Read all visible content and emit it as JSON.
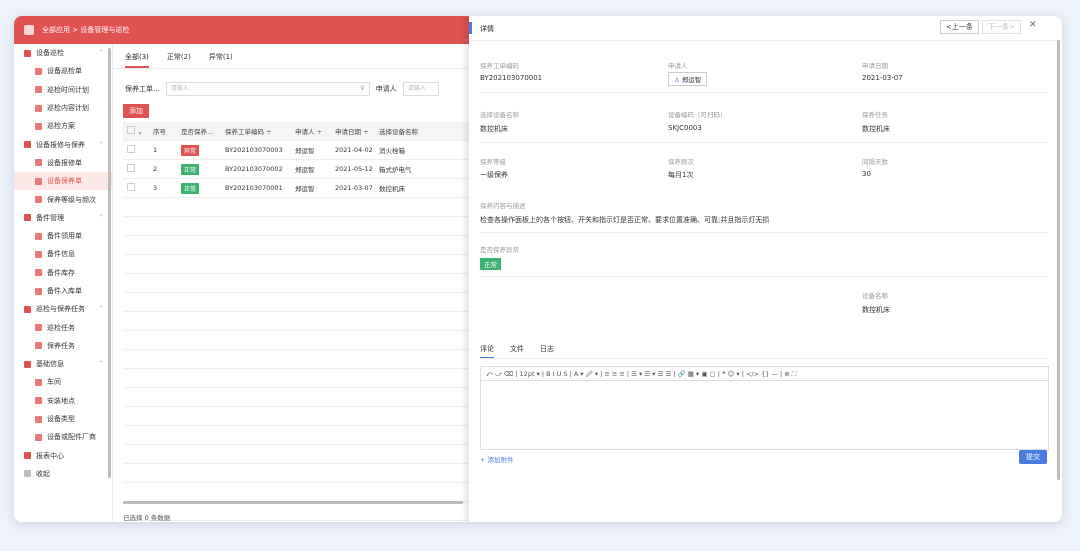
{
  "topbar": {
    "crumb": "全部应用 > 设备管理与巡检"
  },
  "sidebar": {
    "items": [
      {
        "label": "设备巡检",
        "level": "g",
        "chev": "^"
      },
      {
        "label": "设备巡检单",
        "level": "c"
      },
      {
        "label": "巡检时间计划",
        "level": "c"
      },
      {
        "label": "巡检内容计划",
        "level": "c"
      },
      {
        "label": "巡检方案",
        "level": "c"
      },
      {
        "label": "设备报修与保养",
        "level": "g",
        "chev": "^"
      },
      {
        "label": "设备报修单",
        "level": "c"
      },
      {
        "label": "设备保养单",
        "level": "c",
        "active": true
      },
      {
        "label": "保养等级与频次",
        "level": "c"
      },
      {
        "label": "备件管理",
        "level": "g",
        "chev": "^"
      },
      {
        "label": "备件领用单",
        "level": "c"
      },
      {
        "label": "备件信息",
        "level": "c"
      },
      {
        "label": "备件库存",
        "level": "c"
      },
      {
        "label": "备件入库单",
        "level": "c"
      },
      {
        "label": "巡检与保养任务",
        "level": "g",
        "chev": "^"
      },
      {
        "label": "巡检任务",
        "level": "c"
      },
      {
        "label": "保养任务",
        "level": "c"
      },
      {
        "label": "基础信息",
        "level": "g",
        "chev": "^"
      },
      {
        "label": "车间",
        "level": "c"
      },
      {
        "label": "安装地点",
        "level": "c"
      },
      {
        "label": "设备类型",
        "level": "c"
      },
      {
        "label": "设备或配件厂商",
        "level": "c"
      },
      {
        "label": "报表中心",
        "level": "g"
      },
      {
        "label": "收起",
        "level": "g",
        "collapse": true
      }
    ]
  },
  "main": {
    "tabs": [
      "全部(3)",
      "正常(2)",
      "异常(1)"
    ],
    "filter_label": "保养工单...",
    "filter_placeholder": "请输入",
    "applicant_label": "申请人",
    "applicant_placeholder": "请输入",
    "add_label": "添加",
    "columns": [
      "序号",
      "是否保养...",
      "保养工单编码 ÷",
      "申请人 ÷",
      "申请日期 ÷",
      "选择设备名称"
    ],
    "rows": [
      {
        "no": "1",
        "status": "异常",
        "color": "red",
        "code": "BY202103070003",
        "applicant": "郑运智",
        "date": "2021-04-02",
        "device": "消火栓箱"
      },
      {
        "no": "2",
        "status": "正常",
        "color": "green",
        "code": "BY202103070002",
        "applicant": "郑运智",
        "date": "2021-05-12",
        "device": "箱式炉电气"
      },
      {
        "no": "3",
        "status": "正常",
        "color": "green",
        "code": "BY202103070001",
        "applicant": "郑运智",
        "date": "2021-03-07",
        "device": "数控机床"
      }
    ],
    "footer": "已选择 0 条数据"
  },
  "drawer": {
    "title": "详情",
    "prev": "<上一条",
    "next": "下一条>",
    "fields": {
      "code_label": "保养工单编码",
      "code_value": "BY202103070001",
      "applicant_label": "申请人",
      "applicant_value": "郑运智",
      "date_label": "申请日期",
      "date_value": "2021-03-07",
      "device_label": "选择设备名称",
      "device_value": "数控机床",
      "devcode_label": "设备编码（可扫码）",
      "devcode_value": "SKJC0003",
      "task_label": "保养任务",
      "task_value": "数控机床",
      "grade_label": "保养等级",
      "grade_value": "一级保养",
      "freq_label": "保养频次",
      "freq_value": "每月1次",
      "interval_label": "间隔天数",
      "interval_value": "30",
      "content_label": "保养内容与描述",
      "content_value": "检查各操作面板上的各个按钮、开关和指示灯是否正常、要求位置准确、可靠;并且指示灯无损",
      "abnormal_label": "是否保养异常",
      "abnormal_value": "正常",
      "devname_label": "设备名称",
      "devname_value": "数控机床"
    },
    "comment_tabs": [
      "评论",
      "文件",
      "日志"
    ],
    "toolbar_text": "⤺ ⤻ ⌫ | 12pt ▾ | B I U S | A ▾ 🖉 ▾ | ≡ ≡ ≡ | ☰ ▾ ☰ ▾ ☰ ☰ | 🔗 ▦ ▾ ▣ ▢ | ❝ ☺ ▾ | </> {} — | ⊕ ⛶",
    "attach_label": "+ 添加附件",
    "submit_label": "提交"
  }
}
